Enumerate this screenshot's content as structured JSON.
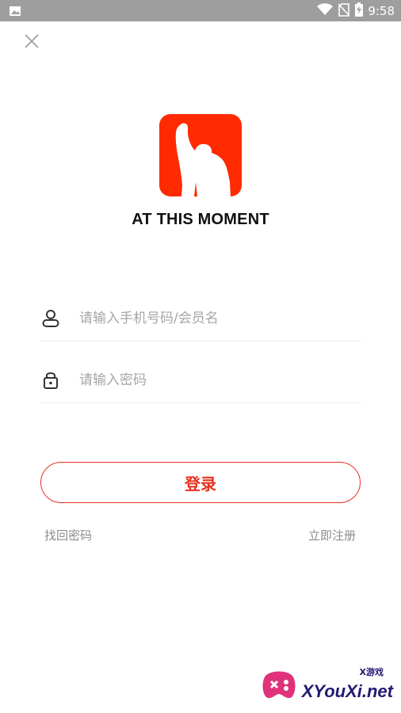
{
  "status_bar": {
    "time": "9:58",
    "icons": [
      "image-icon",
      "wifi-icon",
      "no-sim-icon",
      "battery-charging-icon"
    ]
  },
  "header": {
    "close_icon": "close-icon"
  },
  "app": {
    "title": "AT THIS MOMENT",
    "logo_icon": "raised-fist-person-logo",
    "brand_color": "#ff2a00"
  },
  "form": {
    "username_placeholder": "请输入手机号码/会员名",
    "username_icon": "user-icon",
    "password_placeholder": "请输入密码",
    "password_icon": "lock-icon",
    "login_label": "登录",
    "accent_color": "#e8311e"
  },
  "links": {
    "forgot_password": "找回密码",
    "register": "立即注册"
  },
  "watermark": {
    "text": "XYouXi.net",
    "small_text": "X游戏"
  }
}
